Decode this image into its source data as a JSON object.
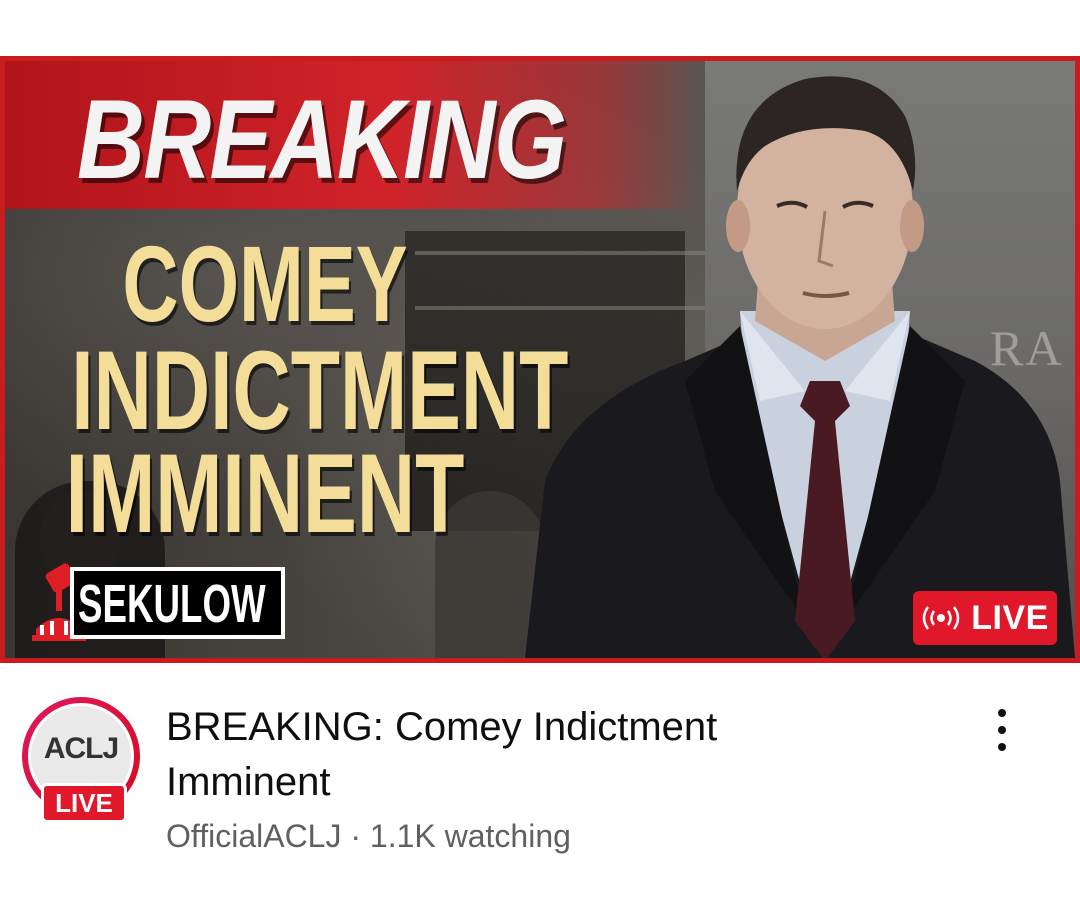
{
  "video": {
    "thumbnail": {
      "banner_text": "BREAKING",
      "headline_lines": [
        "COMEY",
        "INDICTMENT",
        "IMMINENT"
      ],
      "logo_text": "SEKULOW",
      "building_sign": "RA",
      "live_badge": "LIVE"
    },
    "title": "BREAKING: Comey Indictment Imminent",
    "channel": "OfficialACLJ",
    "separator": "·",
    "watching": "1.1K watching",
    "avatar": {
      "label": "ACLJ",
      "live_badge": "LIVE"
    }
  },
  "colors": {
    "live_red": "#e1182a",
    "thumb_border": "#c81c1f",
    "headline_yellow": "#f4dd99",
    "title_text": "#0f0f0f",
    "meta_text": "#606060"
  },
  "icons": {
    "live": "broadcast-icon",
    "menu": "more-vert-icon"
  }
}
